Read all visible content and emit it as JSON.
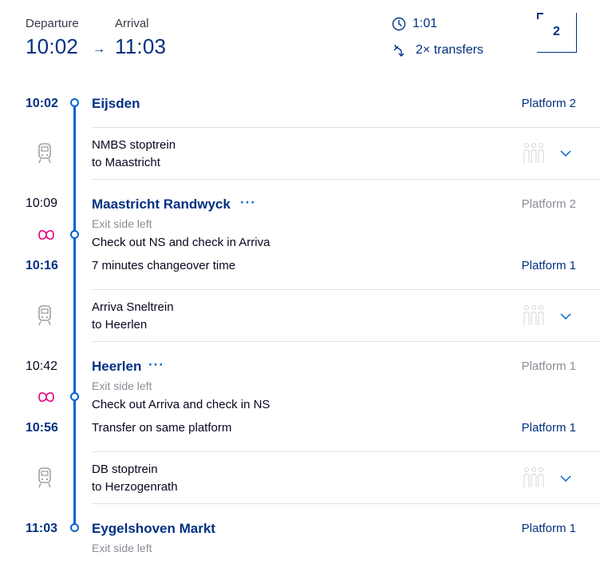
{
  "header": {
    "departure_label": "Departure",
    "arrival_label": "Arrival",
    "departure_time": "10:02",
    "arrival_time": "11:03",
    "arrow": "→",
    "duration": "1:01",
    "transfers": "2× transfers",
    "crowd_level": "2",
    "icons": [
      "clock-icon",
      "transfer-icon"
    ]
  },
  "colors": {
    "primary": "#003082",
    "accent": "#0063d3",
    "ovchip": "#e6007e",
    "muted": "#8c8c96"
  },
  "stops": [
    {
      "time": "10:02",
      "name": "Eijsden",
      "platform": "Platform 2"
    },
    {
      "arr_time": "10:09",
      "dep_time": "10:16",
      "name": "Maastricht Randwyck",
      "more": "···",
      "exit": "Exit side left",
      "checkout": "Check out NS and check in Arriva",
      "changeover": "7 minutes changeover time",
      "arr_platform": "Platform 2",
      "dep_platform": "Platform 1"
    },
    {
      "arr_time": "10:42",
      "dep_time": "10:56",
      "name": "Heerlen",
      "more": "···",
      "exit": "Exit side left",
      "checkout": "Check out Arriva and check in NS",
      "changeover": "Transfer on same platform",
      "arr_platform": "Platform 1",
      "dep_platform": "Platform 1"
    },
    {
      "time": "11:03",
      "name": "Eygelshoven Markt",
      "platform": "Platform 1",
      "exit": "Exit side left"
    }
  ],
  "legs": [
    {
      "operator": "NMBS stoptrein",
      "direction": "to Maastricht"
    },
    {
      "operator": "Arriva Sneltrein",
      "direction": "to Heerlen"
    },
    {
      "operator": "DB stoptrein",
      "direction": "to Herzogenrath"
    }
  ]
}
